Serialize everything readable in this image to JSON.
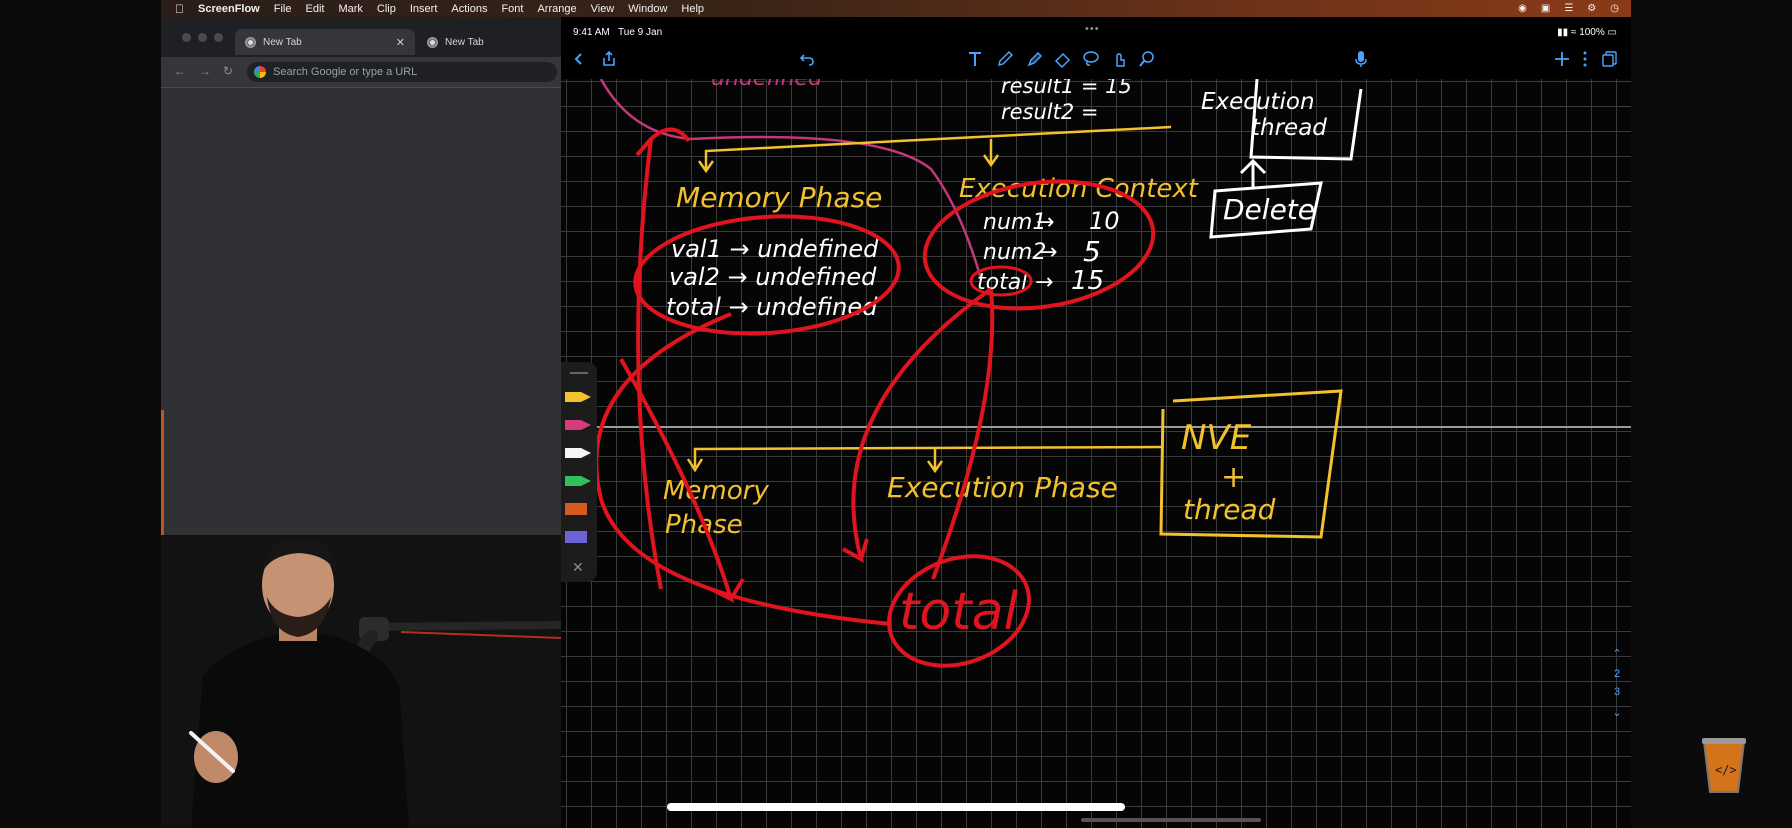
{
  "menubar": {
    "app_name": "ScreenFlow",
    "items": [
      "File",
      "Edit",
      "Mark",
      "Clip",
      "Insert",
      "Actions",
      "Font",
      "Arrange",
      "View",
      "Window",
      "Help"
    ],
    "battery": "100%"
  },
  "browser": {
    "tabs": [
      {
        "label": "New Tab",
        "active": true
      },
      {
        "label": "New Tab",
        "active": false
      }
    ],
    "omnibox_placeholder": "Search Google or type a URL"
  },
  "ipad": {
    "time": "9:41 AM",
    "date": "Tue 9 Jan",
    "battery": "100%",
    "page_numbers": [
      "2",
      "3"
    ]
  },
  "notes": {
    "top_left_partial": "undefined",
    "result_lines": [
      "result1 = 15",
      "result2 ="
    ],
    "execution_thread_box": [
      "Execution",
      "thread"
    ],
    "delete_box": "Delete",
    "memory_phase_title": "Memory Phase",
    "memory_phase_rows": [
      "val1 → undefined",
      "val2 → undefined",
      "total → undefined"
    ],
    "execution_context_title": "Execution Context",
    "execution_context_rows": [
      {
        "name": "num1",
        "value": "10"
      },
      {
        "name": "num2",
        "value": "5"
      },
      {
        "name": "total",
        "value": "15"
      }
    ],
    "nve_box": [
      "NVE",
      "+",
      "thread"
    ],
    "bottom_memory_phase": [
      "Memory",
      "Phase"
    ],
    "bottom_execution_phase": "Execution Phase",
    "bottom_total": "total"
  },
  "colors": {
    "ink_yellow": "#f2c12e",
    "ink_red": "#e0141e",
    "ink_white": "#ffffff",
    "ink_pink": "#c2387a",
    "accent_blue": "#4aa3ff"
  }
}
